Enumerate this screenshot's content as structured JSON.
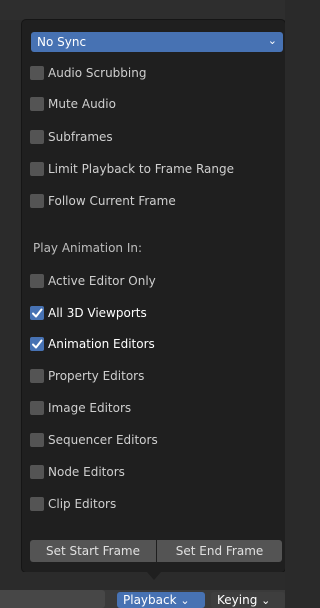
{
  "sync_dropdown": {
    "value": "No Sync",
    "icon": "chevron-down-icon"
  },
  "options": [
    {
      "label": "Audio Scrubbing",
      "checked": false
    },
    {
      "label": "Mute Audio",
      "checked": false
    },
    {
      "label": "Subframes",
      "checked": false
    },
    {
      "label": "Limit Playback to Frame Range",
      "checked": false
    },
    {
      "label": "Follow Current Frame",
      "checked": false
    }
  ],
  "play_animation": {
    "title": "Play Animation In:",
    "items": [
      {
        "label": "Active Editor Only",
        "checked": false
      },
      {
        "label": "All 3D Viewports",
        "checked": true
      },
      {
        "label": "Animation Editors",
        "checked": true
      },
      {
        "label": "Property Editors",
        "checked": false
      },
      {
        "label": "Image Editors",
        "checked": false
      },
      {
        "label": "Sequencer Editors",
        "checked": false
      },
      {
        "label": "Node Editors",
        "checked": false
      },
      {
        "label": "Clip Editors",
        "checked": false
      }
    ]
  },
  "buttons": {
    "set_start": "Set Start Frame",
    "set_end": "Set End Frame"
  },
  "header": {
    "playback": "Playback",
    "keying": "Keying"
  },
  "colors": {
    "accent": "#4772b3",
    "popup_bg": "#1f1f1f",
    "checkbox_off": "#545454",
    "text": "#cfcfcf"
  }
}
